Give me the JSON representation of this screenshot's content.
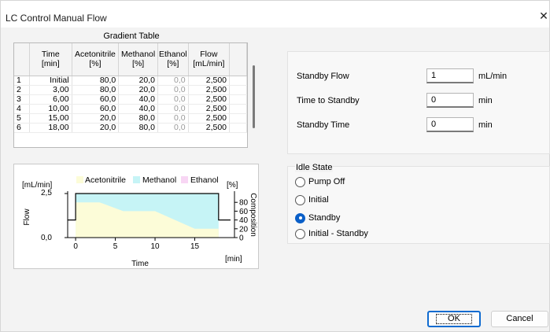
{
  "window": {
    "title": "LC Control Manual Flow",
    "close_glyph": "✕"
  },
  "gradient_table": {
    "title": "Gradient Table",
    "columns": [
      "",
      "Time\n[min]",
      "Acetonitrile\n[%]",
      "Methanol\n[%]",
      "Ethanol\n[%]",
      "Flow\n[mL/min]"
    ],
    "rows": [
      [
        "1",
        "Initial",
        "80,0",
        "20,0",
        "0,0",
        "2,500"
      ],
      [
        "2",
        "3,00",
        "80,0",
        "20,0",
        "0,0",
        "2,500"
      ],
      [
        "3",
        "6,00",
        "60,0",
        "40,0",
        "0,0",
        "2,500"
      ],
      [
        "4",
        "10,00",
        "60,0",
        "40,0",
        "0,0",
        "2,500"
      ],
      [
        "5",
        "15,00",
        "20,0",
        "80,0",
        "0,0",
        "2,500"
      ],
      [
        "6",
        "18,00",
        "20,0",
        "80,0",
        "0,0",
        "2,500"
      ]
    ]
  },
  "chart": {
    "legend": [
      "Acetonitrile",
      "Methanol",
      "Ethanol"
    ],
    "colors": {
      "acetonitrile": "#fcfcd8",
      "methanol": "#c6f4f6",
      "ethanol": "#f8d6f4",
      "flow_line": "#000000"
    },
    "left_unit": "[mL/min]",
    "right_unit": "[%]",
    "ylabel": "Flow",
    "y2label": "Composition",
    "xlabel": "Time",
    "x_unit": "[min]",
    "y_ticks": [
      "2,5",
      "0,0"
    ],
    "y2_ticks": [
      "80",
      "60",
      "40",
      "20",
      "0"
    ],
    "x_ticks": [
      "0",
      "5",
      "10",
      "15"
    ]
  },
  "chart_data": {
    "type": "area",
    "title": "",
    "xlabel": "Time",
    "ylabel": "Flow",
    "y2label": "Composition",
    "xlim": [
      -1,
      20
    ],
    "ylim": [
      0,
      2.5
    ],
    "y2lim": [
      0,
      100
    ],
    "x": [
      0,
      3,
      6,
      10,
      15,
      18
    ],
    "series": [
      {
        "name": "Acetonitrile",
        "axis": "composition",
        "values": [
          80,
          80,
          60,
          60,
          20,
          20
        ]
      },
      {
        "name": "Methanol",
        "axis": "composition",
        "values": [
          20,
          20,
          40,
          40,
          80,
          80
        ]
      },
      {
        "name": "Ethanol",
        "axis": "composition",
        "values": [
          0,
          0,
          0,
          0,
          0,
          0
        ]
      },
      {
        "axis": "flow",
        "x": [
          -1,
          0,
          0,
          18,
          18,
          19.5
        ],
        "values": [
          1,
          1,
          2.5,
          2.5,
          1,
          1
        ]
      }
    ],
    "legend_position": "top",
    "grid": false
  },
  "standby": {
    "flow_label": "Standby Flow",
    "flow_value": "1",
    "flow_unit": "mL/min",
    "time_to_label": "Time to Standby",
    "time_to_value": "0",
    "time_to_unit": "min",
    "time_label": "Standby Time",
    "time_value": "0",
    "time_unit": "min"
  },
  "idle_state": {
    "legend": "Idle State",
    "options": [
      "Pump Off",
      "Initial",
      "Standby",
      "Initial - Standby"
    ],
    "selected": "Standby"
  },
  "buttons": {
    "ok": "OK",
    "cancel": "Cancel"
  }
}
